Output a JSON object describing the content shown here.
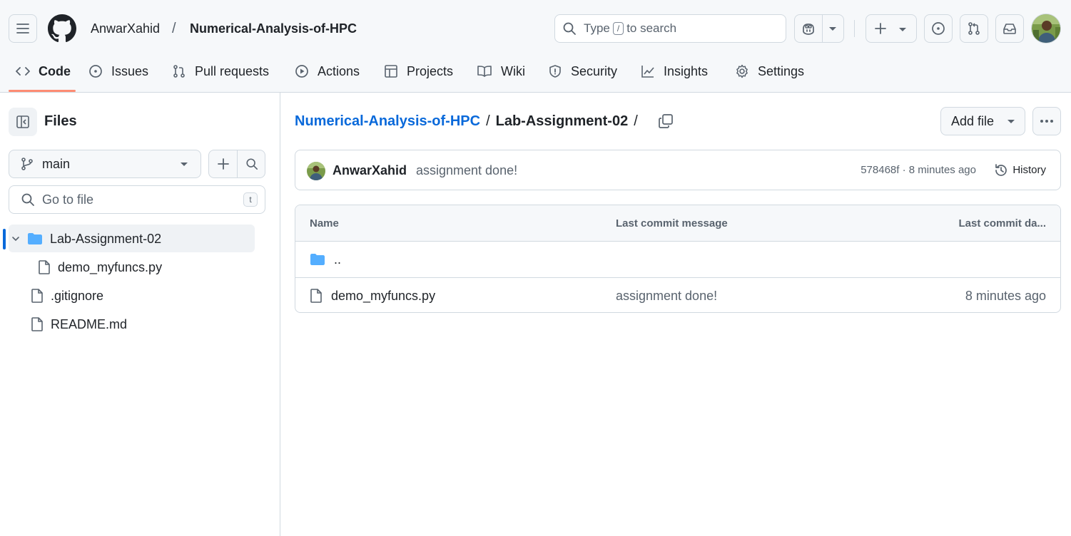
{
  "header": {
    "owner": "AnwarXahid",
    "separator": "/",
    "repo": "Numerical-Analysis-of-HPC",
    "search": {
      "prefix": "Type",
      "key": "/",
      "suffix": "to search"
    }
  },
  "repo_nav": {
    "tabs": [
      {
        "label": "Code",
        "icon": "code-icon",
        "active": true
      },
      {
        "label": "Issues",
        "icon": "issue-icon"
      },
      {
        "label": "Pull requests",
        "icon": "pull-request-icon"
      },
      {
        "label": "Actions",
        "icon": "play-icon"
      },
      {
        "label": "Projects",
        "icon": "table-icon"
      },
      {
        "label": "Wiki",
        "icon": "book-icon"
      },
      {
        "label": "Security",
        "icon": "shield-icon"
      },
      {
        "label": "Insights",
        "icon": "graph-icon"
      },
      {
        "label": "Settings",
        "icon": "gear-icon"
      }
    ]
  },
  "sidebar": {
    "title": "Files",
    "branch": "main",
    "goto_placeholder": "Go to file",
    "goto_shortcut": "t",
    "tree": [
      {
        "label": "Lab-Assignment-02",
        "type": "folder",
        "expanded": true,
        "selected": true
      },
      {
        "label": "demo_myfuncs.py",
        "type": "file"
      },
      {
        "label": ".gitignore",
        "type": "file"
      },
      {
        "label": "README.md",
        "type": "file"
      }
    ]
  },
  "main": {
    "breadcrumb": {
      "repo": "Numerical-Analysis-of-HPC",
      "sep": "/",
      "current": "Lab-Assignment-02",
      "trail": "/"
    },
    "add_file_label": "Add file",
    "commit": {
      "author": "AnwarXahid",
      "message": "assignment done!",
      "meta": "578468f · 8 minutes ago",
      "history_label": "History"
    },
    "table": {
      "headers": {
        "name": "Name",
        "message": "Last commit message",
        "date": "Last commit da..."
      },
      "parent_label": "..",
      "rows": [
        {
          "name": "demo_myfuncs.py",
          "message": "assignment done!",
          "age": "8 minutes ago"
        }
      ]
    }
  },
  "colors": {
    "accent": "#0969da",
    "tab_underline": "#fd8c73",
    "folder": "#54aeff",
    "border": "#d1d9e0"
  }
}
